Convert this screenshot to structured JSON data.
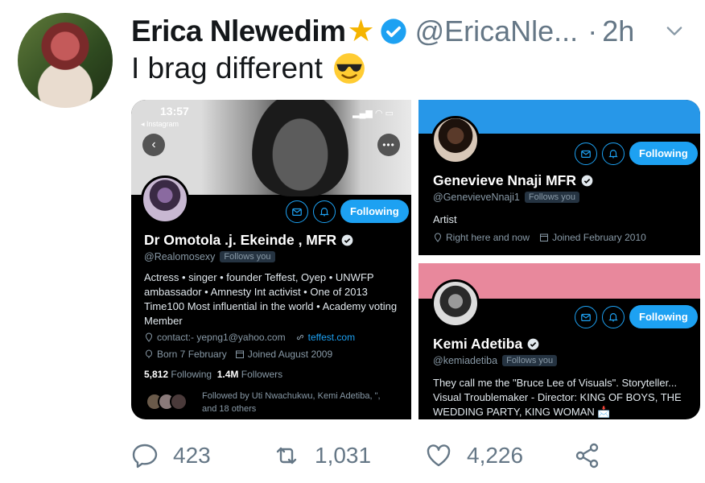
{
  "tweet": {
    "author_name": "Erica Nlewedim",
    "author_handle": "@EricaNle...",
    "time": "2h",
    "dot": "·",
    "text": "I brag different",
    "emoji_icon": "sunglasses-emoji-icon",
    "star_icon": "star-emoji-icon",
    "replies": "423",
    "retweets": "1,031",
    "likes": "4,226"
  },
  "left_card": {
    "status_time": "13:57",
    "status_app": "◂ Instagram",
    "name": "Dr Omotola .j. Ekeinde , MFR",
    "handle": "@Realomosexy",
    "follows_you": "Follows you",
    "follow_label": "Following",
    "bio": "Actress • singer • founder Teffest, Oyep • UNWFP ambassador • Amnesty Int activist • One of 2013 Time100 Most influential in the world • Academy voting Member",
    "contact": "contact:- yepng1@yahoo.com",
    "website": "teffest.com",
    "born": "Born 7 February",
    "joined": "Joined August 2009",
    "following_count": "5,812",
    "following_label": "Following",
    "followers_count": "1.4M",
    "followers_label": "Followers",
    "followed_by": "Followed by Uti Nwachukwu, Kemi Adetiba, \", and 18 others"
  },
  "right_top_card": {
    "name": "Genevieve Nnaji MFR",
    "handle": "@GenevieveNnaji1",
    "follows_you": "Follows you",
    "follow_label": "Following",
    "bio": "Artist",
    "location": "Right here and now",
    "joined": "Joined February 2010"
  },
  "right_bottom_card": {
    "name": "Kemi Adetiba",
    "handle": "@kemiadetiba",
    "follows_you": "Follows you",
    "follow_label": "Following",
    "bio": "They call me the \"Bruce Lee of Visuals\". Storyteller... Visual Troublemaker - Director: KING OF BOYS, THE WEDDING PARTY, KING WOMAN 📩"
  },
  "colors": {
    "twitter_blue": "#1da1f2",
    "verified_blue": "#1da1f2",
    "muted_text": "#657786",
    "card_bg": "#000000"
  }
}
